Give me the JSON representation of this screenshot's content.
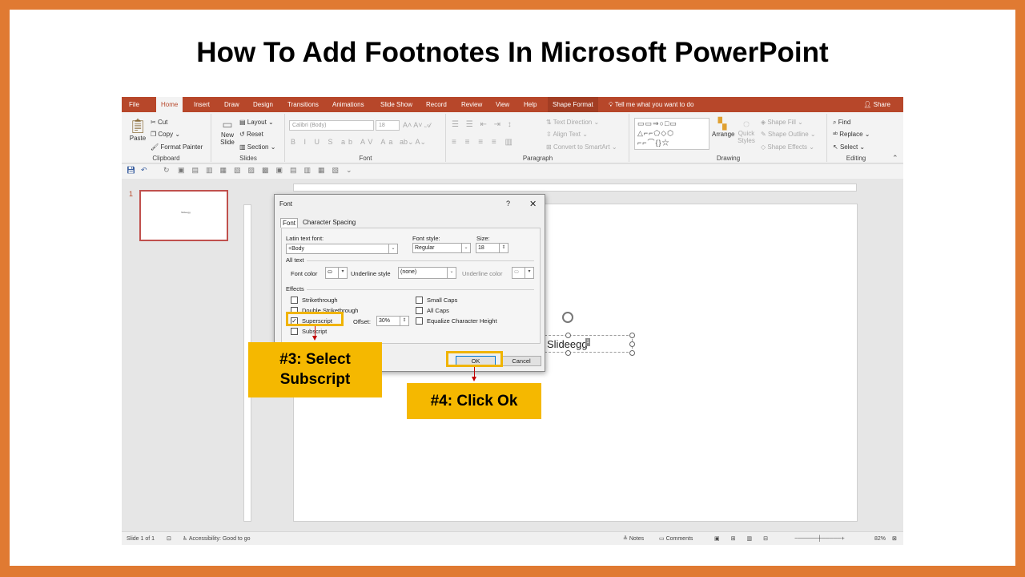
{
  "slide_title": "How To Add Footnotes In Microsoft PowerPoint",
  "tabs": [
    "File",
    "Home",
    "Insert",
    "Draw",
    "Design",
    "Transitions",
    "Animations",
    "Slide Show",
    "Record",
    "Review",
    "View",
    "Help",
    "Shape Format"
  ],
  "active_tab": "Home",
  "tell_me": "Tell me what you want to do",
  "share": "Share",
  "ribbon": {
    "clipboard": {
      "paste": "Paste",
      "cut": "Cut",
      "copy": "Copy",
      "format_painter": "Format Painter",
      "label": "Clipboard"
    },
    "slides": {
      "new_slide": "New Slide",
      "layout": "Layout",
      "reset": "Reset",
      "section": "Section",
      "label": "Slides"
    },
    "font": {
      "font_name": "Calibri (Body)",
      "font_size": "18",
      "label": "Font"
    },
    "paragraph": {
      "text_direction": "Text Direction",
      "align_text": "Align Text",
      "convert_smartart": "Convert to SmartArt",
      "label": "Paragraph"
    },
    "drawing": {
      "arrange": "Arrange",
      "quick_styles": "Quick Styles",
      "shape_fill": "Shape Fill",
      "shape_outline": "Shape Outline",
      "shape_effects": "Shape Effects",
      "label": "Drawing"
    },
    "editing": {
      "find": "Find",
      "replace": "Replace",
      "select": "Select",
      "label": "Editing"
    }
  },
  "thumbnail_number": "1",
  "thumbnail_text": "Slideegg",
  "textbox_text": "Slideegg",
  "textbox_superscript": "1",
  "status": {
    "slide": "Slide 1 of 1",
    "accessibility": "Accessibility: Good to go",
    "notes": "Notes",
    "comments": "Comments",
    "zoom": "82%"
  },
  "dialog": {
    "title": "Font",
    "help": "?",
    "close": "✕",
    "tab_font": "Font",
    "tab_spacing": "Character Spacing",
    "latin_label": "Latin text font:",
    "latin_value": "+Body",
    "style_label": "Font style:",
    "style_value": "Regular",
    "size_label": "Size:",
    "size_value": "18",
    "all_text": "All text",
    "font_color": "Font color",
    "underline_style_label": "Underline style",
    "underline_style_value": "(none)",
    "underline_color": "Underline color",
    "effects": "Effects",
    "strikethrough": "Strikethrough",
    "double_strikethrough": "Double Strikethrough",
    "superscript": "Superscript",
    "subscript": "Subscript",
    "offset_label": "Offset:",
    "offset_value": "30%",
    "small_caps": "Small Caps",
    "all_caps": "All Caps",
    "equalize": "Equalize Character Height",
    "ok": "OK",
    "cancel": "Cancel"
  },
  "callouts": {
    "step3": "#3: Select Subscript",
    "step4": "#4: Click Ok"
  },
  "colors": {
    "border": "#e07a32",
    "tabbar": "#b7472a",
    "callout": "#f5b800",
    "highlight": "#f0b400",
    "arrow": "#c00000"
  }
}
